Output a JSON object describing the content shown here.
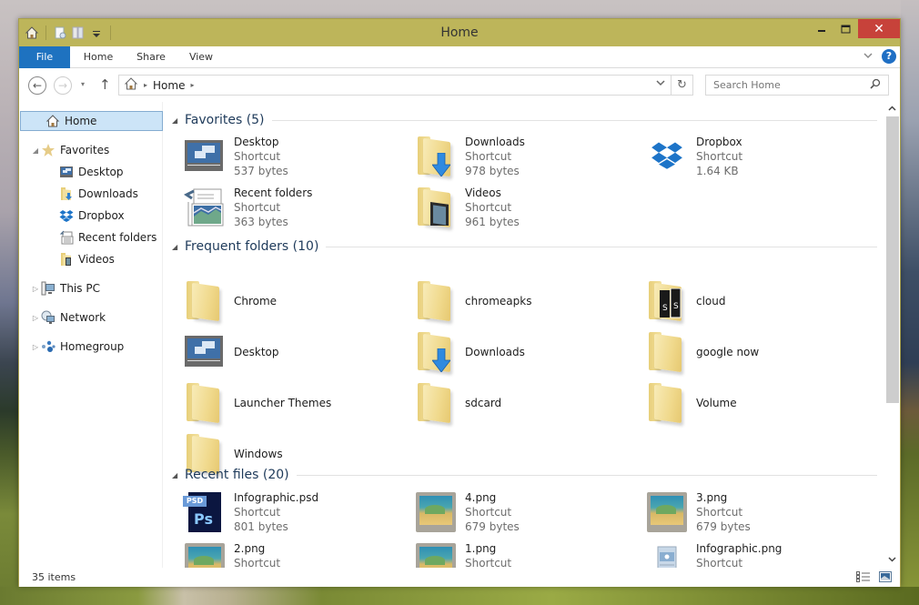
{
  "window": {
    "title": "Home",
    "controls": {
      "minimize": "–",
      "maximize": "□",
      "close": "✕"
    }
  },
  "quick_access": {
    "icons": [
      "home-icon",
      "properties-icon",
      "new-folder-icon",
      "customize-dropdown-icon"
    ]
  },
  "ribbon": {
    "tabs": [
      {
        "label": "File",
        "active": true
      },
      {
        "label": "Home"
      },
      {
        "label": "Share"
      },
      {
        "label": "View"
      }
    ],
    "expand_icon": "chevron-down-icon",
    "help_label": "?"
  },
  "navigation": {
    "back": "←",
    "forward": "→",
    "recent": "▾",
    "up": "↑",
    "address": {
      "crumbs": [
        "Home"
      ],
      "sep": "▸",
      "dropdown": "⌄",
      "refresh": "↻"
    },
    "search": {
      "placeholder": "Search Home",
      "value": ""
    }
  },
  "sidebar": {
    "home": {
      "label": "Home",
      "selected": true
    },
    "favorites": {
      "label": "Favorites",
      "expanded": true,
      "items": [
        {
          "label": "Desktop",
          "icon": "desktop-icon"
        },
        {
          "label": "Downloads",
          "icon": "downloads-icon"
        },
        {
          "label": "Dropbox",
          "icon": "dropbox-icon"
        },
        {
          "label": "Recent folders",
          "icon": "recent-folders-icon"
        },
        {
          "label": "Videos",
          "icon": "videos-icon"
        }
      ]
    },
    "roots": [
      {
        "label": "This PC",
        "icon": "this-pc-icon"
      },
      {
        "label": "Network",
        "icon": "network-icon"
      },
      {
        "label": "Homegroup",
        "icon": "homegroup-icon"
      }
    ]
  },
  "content": {
    "favorites": {
      "label": "Favorites (5)",
      "items": [
        {
          "name": "Desktop",
          "type": "Shortcut",
          "size": "537 bytes",
          "icon": "desktop-icon"
        },
        {
          "name": "Downloads",
          "type": "Shortcut",
          "size": "978 bytes",
          "icon": "downloads-folder-icon"
        },
        {
          "name": "Dropbox",
          "type": "Shortcut",
          "size": "1.64 KB",
          "icon": "dropbox-icon"
        },
        {
          "name": "Recent folders",
          "type": "Shortcut",
          "size": "363 bytes",
          "icon": "recent-folders-icon"
        },
        {
          "name": "Videos",
          "type": "Shortcut",
          "size": "961 bytes",
          "icon": "videos-folder-icon"
        }
      ]
    },
    "frequent": {
      "label": "Frequent folders (10)",
      "items": [
        {
          "name": "Chrome",
          "icon": "folder-icon"
        },
        {
          "name": "chromeapks",
          "icon": "folder-icon"
        },
        {
          "name": "cloud",
          "icon": "cloud-folder-icon"
        },
        {
          "name": "Desktop",
          "icon": "desktop-icon"
        },
        {
          "name": "Downloads",
          "icon": "downloads-folder-icon"
        },
        {
          "name": "google now",
          "icon": "folder-icon"
        },
        {
          "name": "Launcher Themes",
          "icon": "folder-icon"
        },
        {
          "name": "sdcard",
          "icon": "folder-icon"
        },
        {
          "name": "Volume",
          "icon": "folder-icon"
        },
        {
          "name": "Windows",
          "icon": "folder-icon"
        }
      ]
    },
    "recent_files": {
      "label": "Recent files (20)",
      "items": [
        {
          "name": "Infographic.psd",
          "type": "Shortcut",
          "size": "801 bytes",
          "icon": "psd-file-icon"
        },
        {
          "name": "4.png",
          "type": "Shortcut",
          "size": "679 bytes",
          "icon": "image-file-icon"
        },
        {
          "name": "3.png",
          "type": "Shortcut",
          "size": "679 bytes",
          "icon": "image-file-icon"
        },
        {
          "name": "2.png",
          "type": "Shortcut",
          "size": "",
          "icon": "image-file-icon"
        },
        {
          "name": "1.png",
          "type": "Shortcut",
          "size": "",
          "icon": "image-file-icon"
        },
        {
          "name": "Infographic.png",
          "type": "Shortcut",
          "size": "",
          "icon": "png-file-icon"
        }
      ]
    }
  },
  "status": {
    "count": "35 items",
    "views": [
      "details-view-icon",
      "large-icons-view-icon"
    ]
  },
  "colors": {
    "titlebar": "#bdb55a",
    "file_tab": "#1e72c0",
    "close": "#c7423a",
    "selection": "#cce4f7",
    "group_header": "#1e3a5a"
  }
}
